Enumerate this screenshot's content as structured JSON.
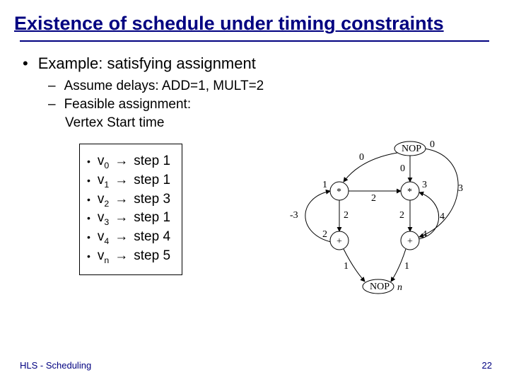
{
  "title": "Existence of schedule under timing constraints",
  "example_label": "Example: satisfying assignment",
  "assume_line": "Assume delays: ADD=1, MULT=2",
  "feasible_line": "Feasible assignment:",
  "vertex_start_line": "Vertex    Start time",
  "assignments": [
    {
      "vertex": "v",
      "sub": "0",
      "step": "step 1"
    },
    {
      "vertex": "v",
      "sub": "1",
      "step": "step 1"
    },
    {
      "vertex": "v",
      "sub": "2",
      "step": "step 3"
    },
    {
      "vertex": "v",
      "sub": "3",
      "step": "step 1"
    },
    {
      "vertex": "v",
      "sub": "4",
      "step": "step 4"
    },
    {
      "vertex": "v",
      "sub": "n",
      "step": "step 5"
    }
  ],
  "diagram": {
    "nodes": {
      "nop_top": "NOP",
      "mult_left": "*",
      "mult_right": "*",
      "add_left": "+",
      "add_right": "+",
      "nop_bottom": "NOP"
    },
    "node_ids": {
      "mult_left": "1",
      "mult_right": "3",
      "add_left": "2",
      "add_right": "4",
      "nop_bottom": "n",
      "nop_top": "0"
    },
    "edge_weights": {
      "top_to_mleft": "0",
      "top_to_mright": "0",
      "top_to_aright": "3",
      "mleft_to_aleft": "2",
      "mright_to_aright": "2",
      "aleft_to_bottom": "1",
      "aright_to_bottom": "1",
      "mleft_to_mright": "2",
      "aleft_to_mleft": "-3",
      "aright_to_mright": "4"
    }
  },
  "footer_left": "HLS - Scheduling",
  "footer_right": "22"
}
